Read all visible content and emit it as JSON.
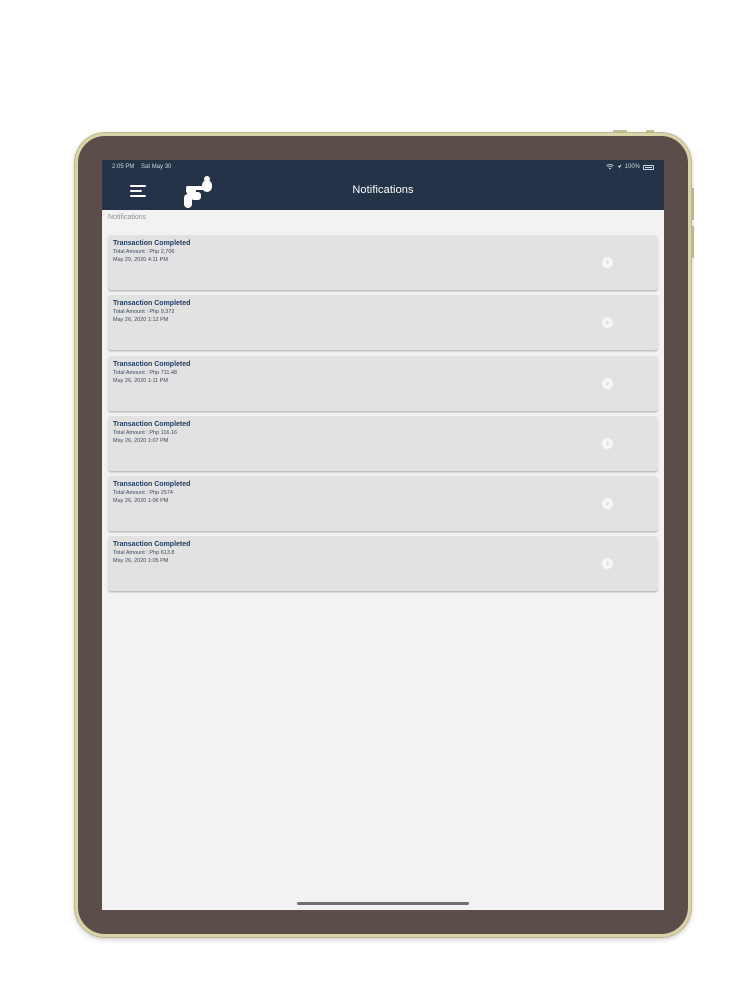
{
  "status": {
    "time": "2:05 PM",
    "date": "Sat May 30",
    "battery": "100%"
  },
  "nav": {
    "title": "Notifications",
    "menu_icon": "hamburger-menu-icon",
    "logo_icon": "app-logo-icon"
  },
  "section_label": "Notifications",
  "notifications": [
    {
      "title": "Transaction Completed",
      "amount": "Total Amount : Php 2,706",
      "date": "May 29, 2020 4:11 PM"
    },
    {
      "title": "Transaction Completed",
      "amount": "Total Amount : Php 9,372",
      "date": "May 26, 2020 1:12 PM"
    },
    {
      "title": "Transaction Completed",
      "amount": "Total Amount : Php 711.48",
      "date": "May 26, 2020 1:11 PM"
    },
    {
      "title": "Transaction Completed",
      "amount": "Total Amount : Php 116.16",
      "date": "May 26, 2020 1:07 PM"
    },
    {
      "title": "Transaction Completed",
      "amount": "Total Amount : Php 2574",
      "date": "May 26, 2020 1:06 PM"
    },
    {
      "title": "Transaction Completed",
      "amount": "Total Amount : Php 613.8",
      "date": "May 26, 2020 1:05 PM"
    }
  ],
  "colors": {
    "navbar": "#243347",
    "title_text": "#1f3a5c",
    "card_bg": "#e2e2e3",
    "screen_bg": "#f2f2f3",
    "device_frame": "#5a4d4a"
  }
}
